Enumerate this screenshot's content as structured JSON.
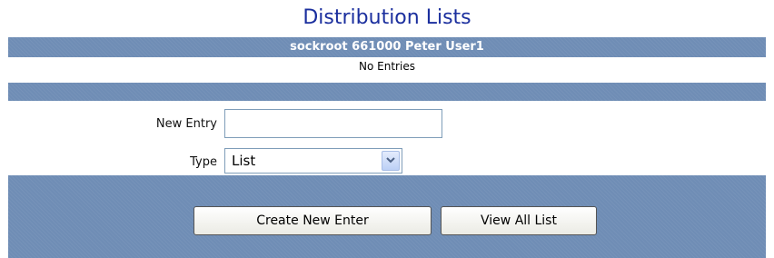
{
  "page": {
    "title": "Distribution Lists"
  },
  "header": {
    "user_line": "sockroot 661000  Peter User1"
  },
  "list": {
    "empty_message": "No Entries"
  },
  "form": {
    "new_entry_label": "New Entry",
    "new_entry_value": "",
    "type_label": "Type",
    "type_selected": "List"
  },
  "actions": {
    "create_label": "Create New Enter",
    "view_all_label": "View All List"
  },
  "colors": {
    "band": "#6f8db5",
    "title": "#1b2f9e"
  }
}
